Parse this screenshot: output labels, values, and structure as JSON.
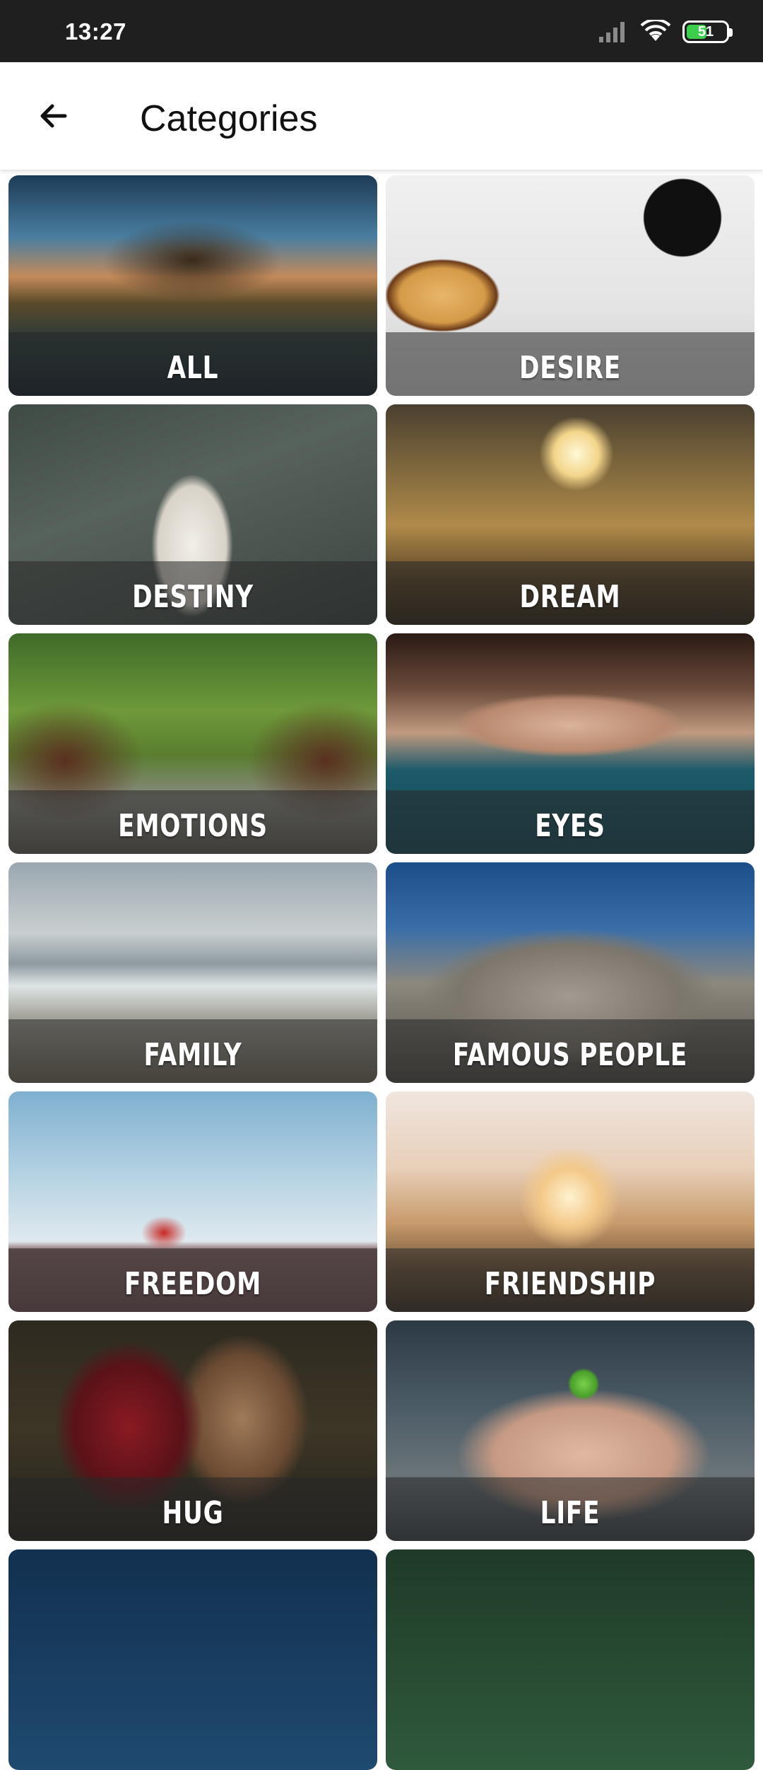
{
  "status_bar": {
    "time": "13:27",
    "battery": "51",
    "icons": [
      "signal-icon",
      "wifi-icon",
      "battery-icon"
    ]
  },
  "app_bar": {
    "title": "Categories",
    "back_icon": "arrow-back-icon"
  },
  "categories": [
    {
      "label": "ALL"
    },
    {
      "label": "DESIRE"
    },
    {
      "label": "DESTINY"
    },
    {
      "label": "DREAM"
    },
    {
      "label": "EMOTIONS"
    },
    {
      "label": "EYES"
    },
    {
      "label": "FAMILY"
    },
    {
      "label": "FAMOUS PEOPLE"
    },
    {
      "label": "FREEDOM"
    },
    {
      "label": "FRIENDSHIP"
    },
    {
      "label": "HUG"
    },
    {
      "label": "LIFE"
    }
  ],
  "colors": {
    "status_bar_bg": "#1f1f1f",
    "app_bar_bg": "#ffffff",
    "battery_fill": "#3ccf4e"
  }
}
